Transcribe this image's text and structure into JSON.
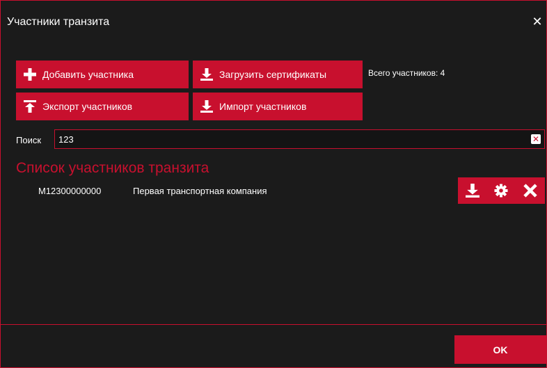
{
  "window": {
    "title": "Участники транзита"
  },
  "toolbar": {
    "add_label": "Добавить участника",
    "load_certs_label": "Загрузить сертификаты",
    "export_label": "Экспорт участников",
    "import_label": "Импорт участников",
    "total_text": "Всего участников: 4"
  },
  "search": {
    "label": "Поиск",
    "value": "123"
  },
  "list": {
    "title": "Список участников транзита",
    "rows": [
      {
        "id": "M12300000000",
        "name": "Первая транспортная компания"
      }
    ]
  },
  "footer": {
    "ok_label": "OK"
  },
  "colors": {
    "accent": "#c8102e",
    "background": "#1b1b1b",
    "text": "#ffffff"
  },
  "icons": [
    "plus-icon",
    "download-icon",
    "upload-icon",
    "close-icon",
    "clear-icon",
    "gear-icon",
    "delete-icon"
  ]
}
